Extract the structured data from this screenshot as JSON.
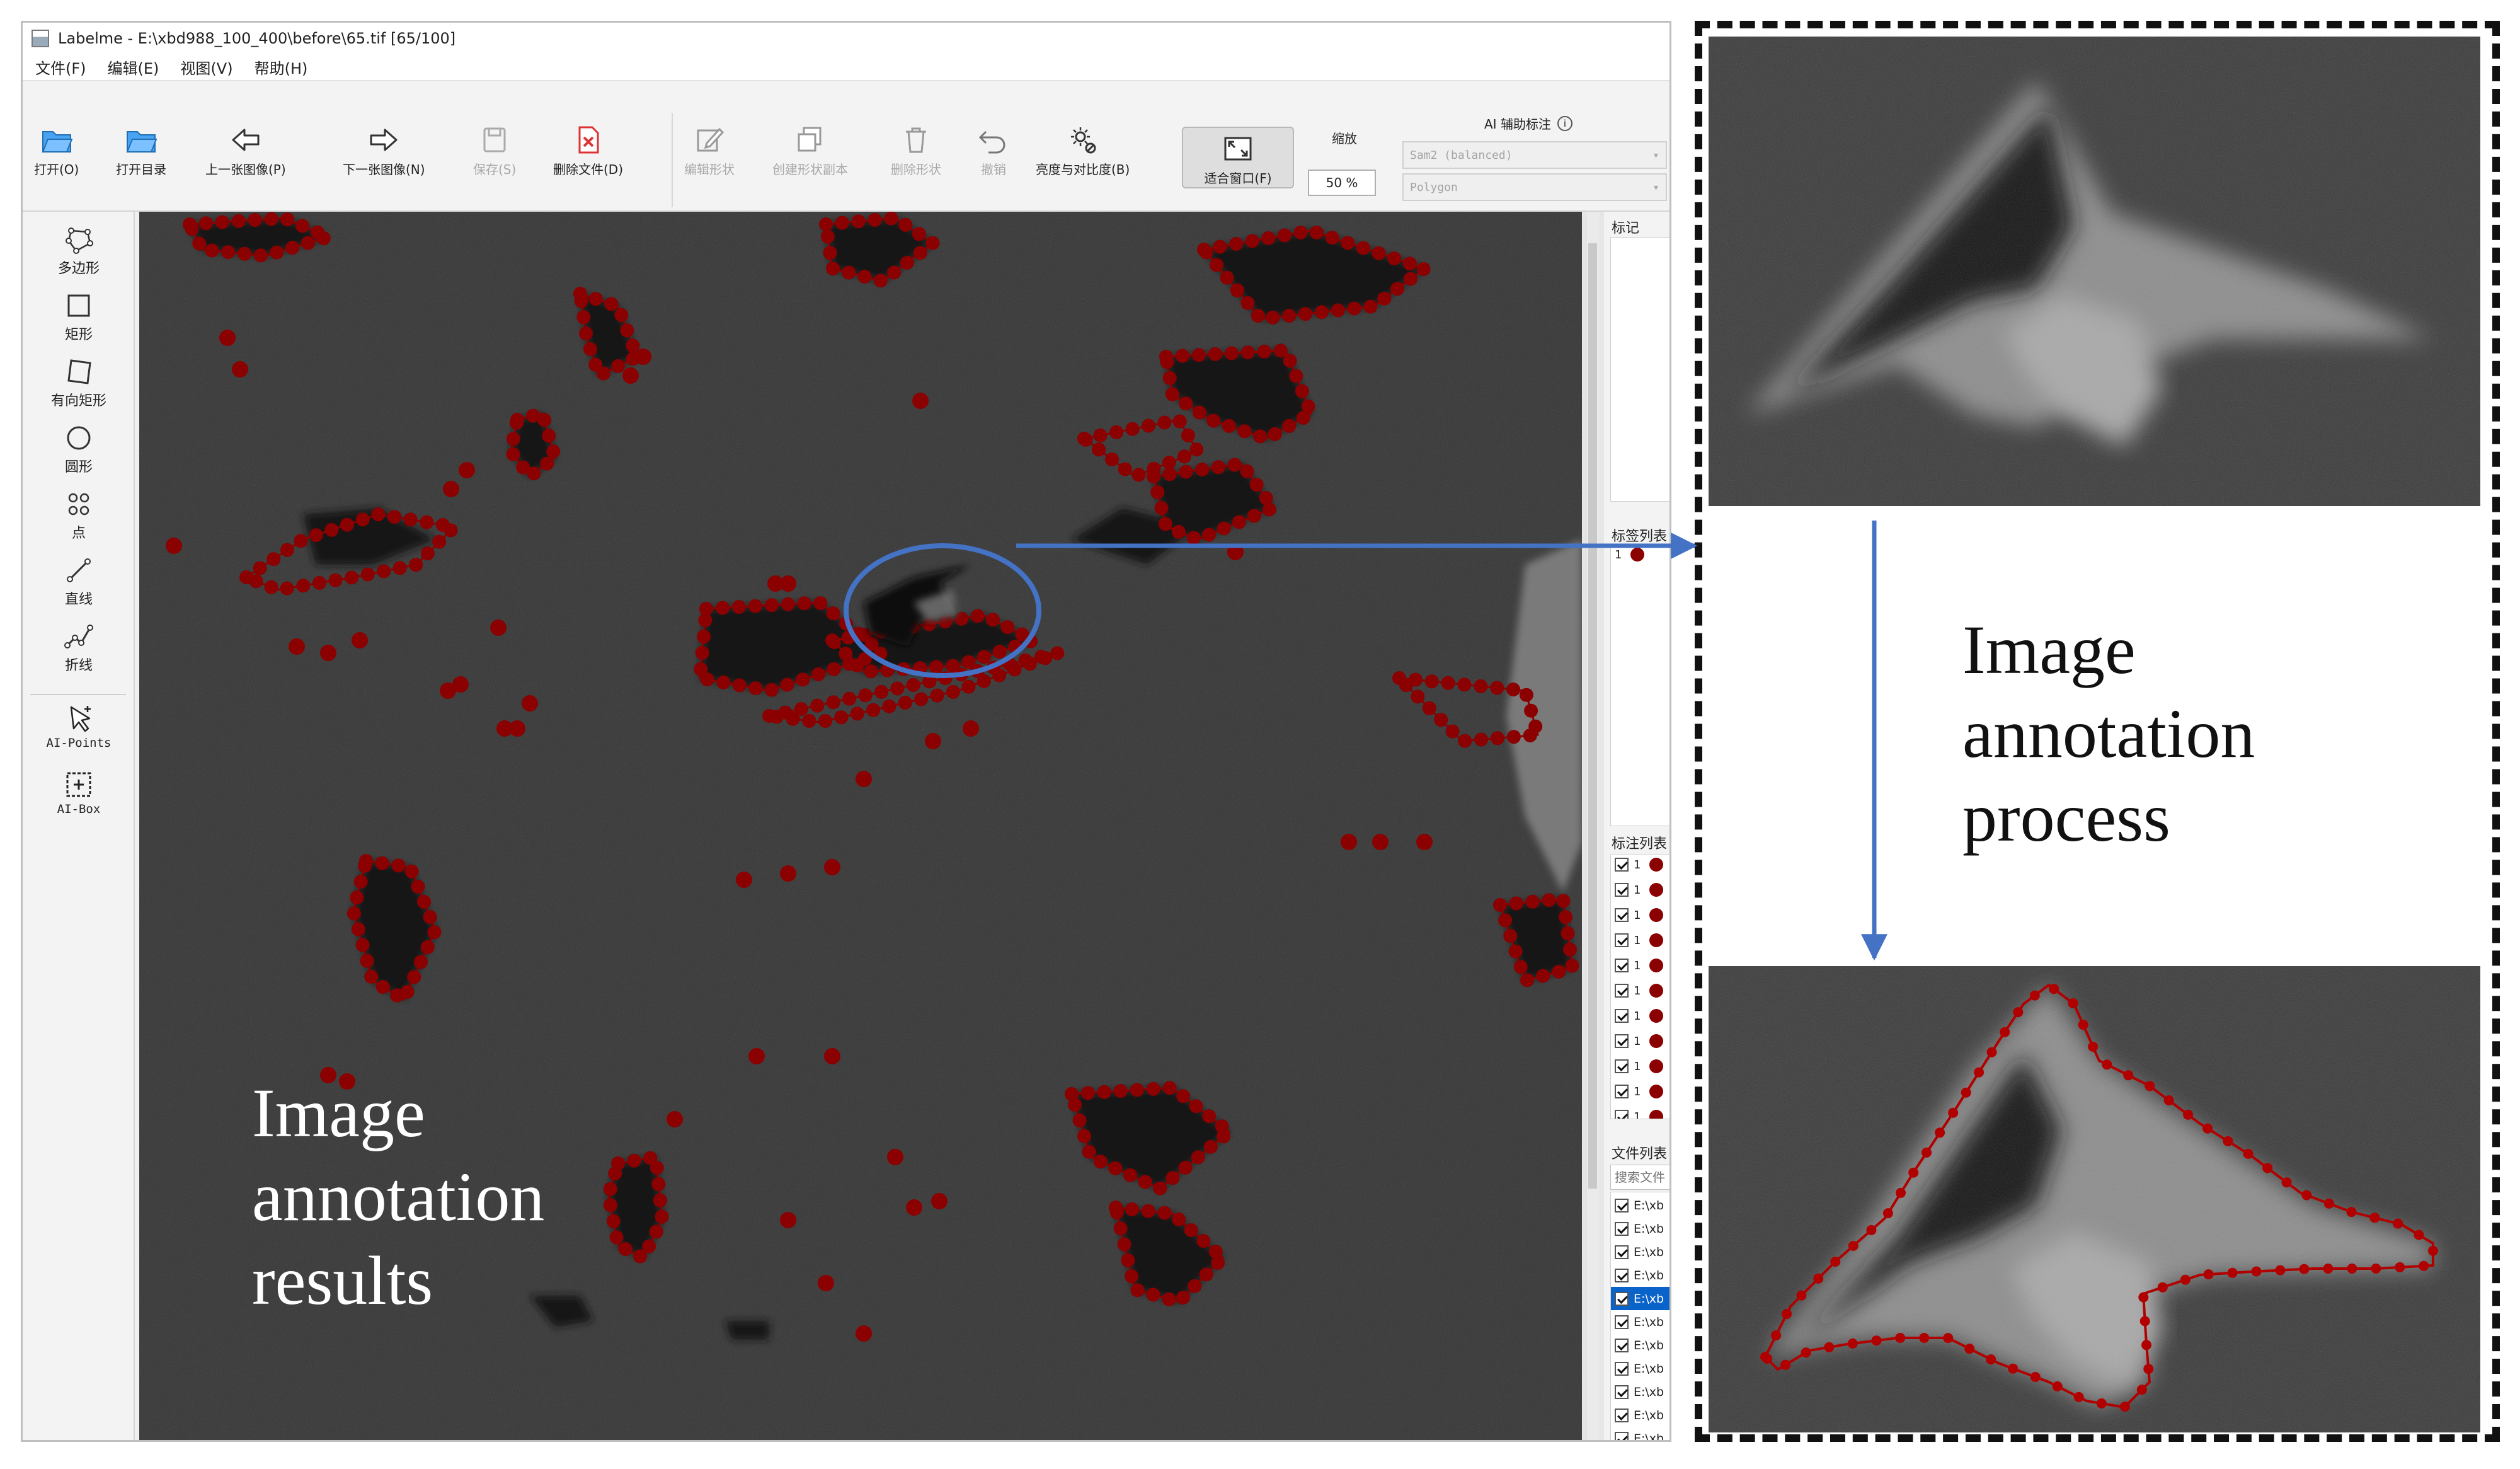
{
  "window": {
    "title": "Labelme - E:\\xbd988_100_400\\before\\65.tif [65/100]"
  },
  "menu": [
    "文件(F)",
    "编辑(E)",
    "视图(V)",
    "帮助(H)"
  ],
  "toolbar": {
    "open": "打开(O)",
    "open_dir": "打开目录",
    "prev": "上一张图像(P)",
    "next": "下一张图像(N)",
    "save": "保存(S)",
    "delete_file": "删除文件(D)",
    "edit_shape": "编辑形状",
    "duplicate": "创建形状副本",
    "delete_shape": "删除形状",
    "undo": "撤销",
    "brightness": "亮度与对比度(B)",
    "fit_window": "适合窗口(F)",
    "zoom_label": "缩放",
    "zoom_value": "50 %",
    "ai_title": "AI 辅助标注",
    "ai_model": "Sam2 (balanced)",
    "ai_output": "Polygon"
  },
  "tools": {
    "polygon": "多边形",
    "rectangle": "矩形",
    "rotated_rect": "有向矩形",
    "circle": "圆形",
    "point": "点",
    "line": "直线",
    "linestrip": "折线",
    "ai_points": "AI-Points",
    "ai_box": "AI-Box"
  },
  "dock": {
    "flags_title": "标记",
    "labels_title": "标签列表",
    "label_items": [
      {
        "text": "1"
      }
    ],
    "shapes_title": "标注列表",
    "shape_items": [
      "1",
      "1",
      "1",
      "1",
      "1",
      "1",
      "1",
      "1",
      "1",
      "1",
      "1"
    ],
    "files_title": "文件列表",
    "file_search_placeholder": "搜索文件",
    "file_items": [
      "E:\\xb",
      "E:\\xb",
      "E:\\xb",
      "E:\\xb",
      "E:\\xb",
      "E:\\xb",
      "E:\\xb",
      "E:\\xb",
      "E:\\xb",
      "E:\\xb",
      "E:\\xb"
    ],
    "selected_file_index": 4
  },
  "captions": {
    "results": [
      "Image",
      "annotation",
      "results"
    ],
    "process": [
      "Image",
      "annotation",
      "process"
    ]
  },
  "colors": {
    "annotation": "#8b0000",
    "arrow": "#4472c4",
    "selection": "#0a63c9"
  }
}
